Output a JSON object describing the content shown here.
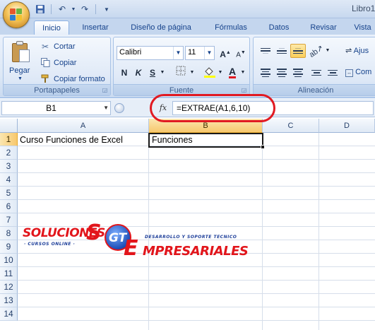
{
  "window": {
    "doc_title": "Libro1"
  },
  "ribbon_tabs": [
    "Inicio",
    "Insertar",
    "Diseño de página",
    "Fórmulas",
    "Datos",
    "Revisar",
    "Vista"
  ],
  "clipboard": {
    "paste_label": "Pegar",
    "cut_label": "Cortar",
    "copy_label": "Copiar",
    "format_painter_label": "Copiar formato",
    "group_label": "Portapapeles"
  },
  "font": {
    "name": "Calibri",
    "size": "11",
    "bold": "N",
    "italic": "K",
    "underline": "S",
    "group_label": "Fuente"
  },
  "alignment": {
    "wrap_label": "Ajus",
    "merge_label": "Com",
    "group_label": "Alineación"
  },
  "formula_bar": {
    "name_box": "B1",
    "fx": "fx",
    "formula": "=EXTRAE(A1,6,10)"
  },
  "sheet": {
    "columns": [
      "A",
      "B",
      "C",
      "D"
    ],
    "rows": [
      "1",
      "2",
      "3",
      "4",
      "5",
      "6",
      "7",
      "8",
      "9",
      "10",
      "11",
      "12",
      "13",
      "14"
    ],
    "cells": {
      "A1": "Curso Funciones de Excel",
      "B1": "Funciones"
    },
    "selected_cell": "B1"
  },
  "watermark": {
    "soluciones": "SOLUCIONES",
    "s": "S",
    "gt": "GT",
    "e": "E",
    "empresariales": "MPRESARIALES",
    "cursos": "· CURSOS ONLINE ·",
    "tagline": "DESARROLLO Y SOPORTE TECNICO"
  },
  "colors": {
    "ribbon": "#dde8f6",
    "selection_header": "#f7c86d",
    "annotation_red": "#e11a22",
    "brand_red": "#e2151b",
    "brand_blue": "#1e3f9a"
  }
}
